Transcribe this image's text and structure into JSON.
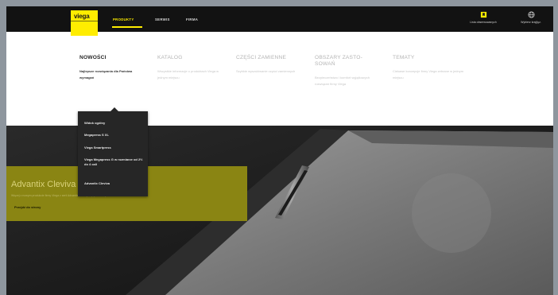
{
  "brand": {
    "logo_text": "viega"
  },
  "nav": {
    "items": [
      {
        "label": "PRODUKTY",
        "active": true
      },
      {
        "label": "SERWIS",
        "active": false
      },
      {
        "label": "FIRMA",
        "active": false
      }
    ]
  },
  "utility": {
    "items": [
      {
        "label": "Lista obserwowanych",
        "icon": "bookmark-icon"
      },
      {
        "label": "Wybierz kraj/jęz.",
        "icon": "globe-icon"
      }
    ]
  },
  "menu": {
    "columns": [
      {
        "title": "NOWOŚCI",
        "text": "Najlepsze rozwiązania dla Państwa wymagań",
        "active": true
      },
      {
        "title": "KATALOG",
        "text": "Wszystkie informacje o produktach Viega w jednym miejscu",
        "active": false
      },
      {
        "title": "CZĘŚCI ZAMIENNE",
        "text": "Szybkie wyszukiwanie części zamiennych",
        "active": false
      },
      {
        "title": "OBSZARY ZASTO-SOWAŃ",
        "text": "Bezpieczeństwo i komfort wyjątkowych rozwiązań firmy Viega",
        "active": false
      },
      {
        "title": "TEMATY",
        "text": "Ciekawe koncepcje firmy Viega zebrane w jednym miejscu",
        "active": false
      }
    ]
  },
  "submenu": {
    "items": [
      {
        "label": "Widok ogólny"
      },
      {
        "label": "Megapress S XL"
      },
      {
        "label": "Viega Smartpress"
      },
      {
        "label": "Viega Megapress G w rozmiarze od 2½ do 4 cali"
      },
      {
        "label": "Advantix Cleviva"
      }
    ]
  },
  "promo": {
    "title": "Advantix Cleviva",
    "subtitle": "Więcej o nowym produkcie firmy Viega z serii Advantix – nowy odpływ liniowy Cleviva",
    "link": "Przejdź do strony"
  },
  "colors": {
    "accent": "#ffed00",
    "promo": "#8a8513"
  }
}
